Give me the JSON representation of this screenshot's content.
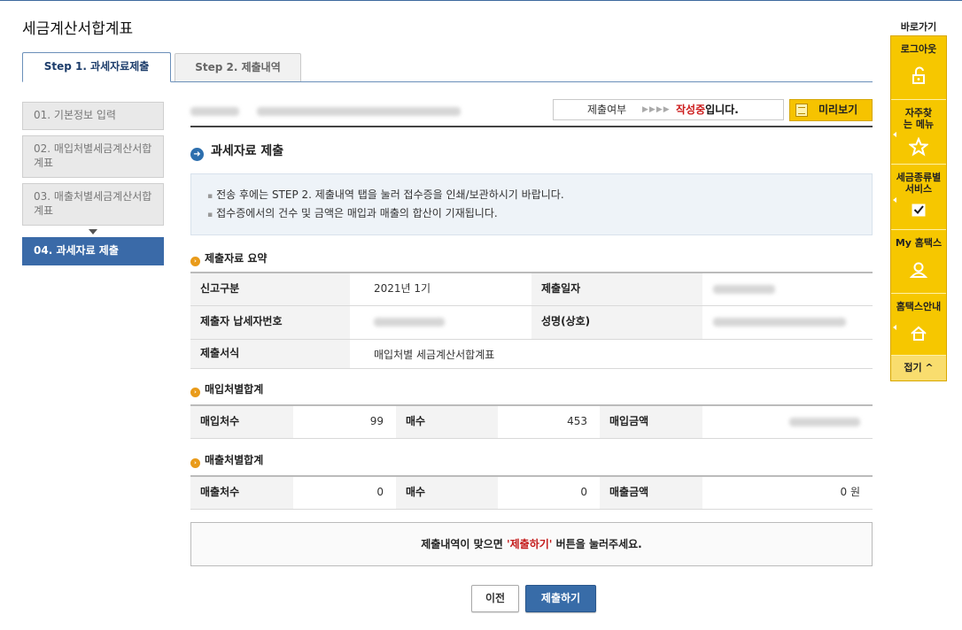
{
  "page": {
    "title": "세금계산서합계표"
  },
  "tabs": [
    {
      "label": "Step 1. 과세자료제출",
      "active": true
    },
    {
      "label": "Step 2. 제출내역",
      "active": false
    }
  ],
  "steps": [
    {
      "num": "01.",
      "label": "기본정보 입력"
    },
    {
      "num": "02.",
      "label": "매입처별세금계산서합계표"
    },
    {
      "num": "03.",
      "label": "매출처별세금계산서합계표"
    },
    {
      "num": "04.",
      "label": "과세자료 제출"
    }
  ],
  "status": {
    "label": "제출여부",
    "arrows": "▶▶▶▶",
    "value_red": "작성중",
    "value_suffix": "입니다."
  },
  "preview_button": "미리보기",
  "section": {
    "title": "과세자료 제출"
  },
  "notice": {
    "line1": "전송 후에는 STEP 2. 제출내역 탭을 눌러 접수증을 인쇄/보관하시기 바랍니다.",
    "line2": "접수증에서의 건수 및 금액은 매입과 매출의 합산이 기재됩니다."
  },
  "summary": {
    "title": "제출자료 요약",
    "report_type_label": "신고구분",
    "report_type_value": "2021년 1기",
    "submit_date_label": "제출일자",
    "submitter_id_label": "제출자 납세자번호",
    "name_label": "성명(상호)",
    "form_label": "제출서식",
    "form_value": "매입처별 세금계산서합계표"
  },
  "purchase": {
    "title": "매입처별합계",
    "count_label": "매입처수",
    "count_value": "99",
    "sheets_label": "매수",
    "sheets_value": "453",
    "amount_label": "매입금액"
  },
  "sales": {
    "title": "매출처별합계",
    "count_label": "매출처수",
    "count_value": "0",
    "sheets_label": "매수",
    "sheets_value": "0",
    "amount_label": "매출금액",
    "amount_value": "0 원"
  },
  "confirm": {
    "prefix": "제출내역이 맞으면",
    "highlight": "'제출하기'",
    "suffix": "버튼을 눌러주세요."
  },
  "buttons": {
    "prev": "이전",
    "submit": "제출하기"
  },
  "quick": {
    "title": "바로가기",
    "items": [
      {
        "label": "로그아웃",
        "icon": "logout-icon"
      },
      {
        "label": "자주찾는 메뉴",
        "icon": "star-icon"
      },
      {
        "label": "세금종류별 서비스",
        "icon": "checkbox-icon"
      },
      {
        "label": "My 홈택스",
        "icon": "user-icon"
      },
      {
        "label": "홈택스안내",
        "icon": "home-icon"
      }
    ],
    "close": "접기 ^"
  },
  "colors": {
    "accent": "#3a6aa8",
    "quick_bg": "#f6c700",
    "status_red": "#cc1b1b"
  }
}
